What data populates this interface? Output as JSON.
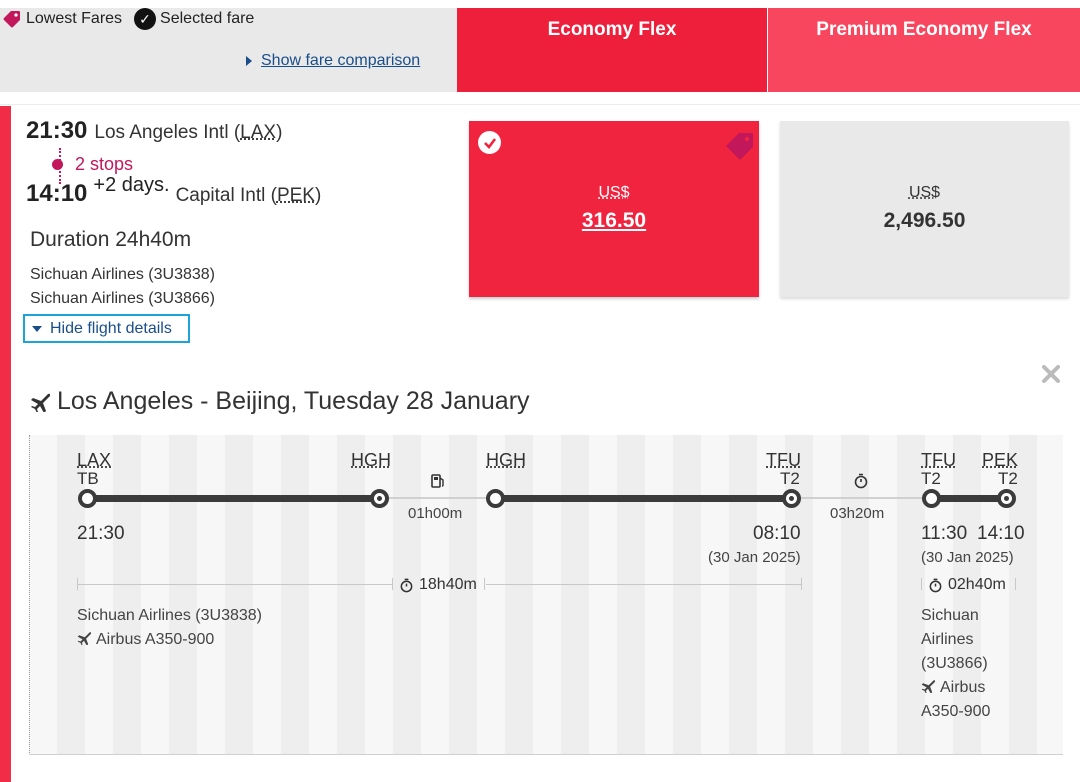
{
  "legend": {
    "lowest_fares": "Lowest Fares",
    "selected_fare": "Selected fare",
    "show_fare_comparison": "Show fare comparison",
    "tag_icon": "price-tag-icon",
    "check_icon": "checkmark-icon"
  },
  "fare_columns": {
    "economy_flex": "Economy Flex",
    "premium_economy_flex": "Premium Economy Flex"
  },
  "flight": {
    "dep_time": "21:30",
    "dep_airport_name": "Los Angeles Intl",
    "dep_code": "LAX",
    "stops": "2 stops",
    "arr_time": "14:10",
    "arr_days": "+2 days.",
    "arr_airport_name": "Capital Intl",
    "arr_code": "PEK",
    "duration": "Duration 24h40m",
    "airlines": [
      "Sichuan Airlines (3U3838)",
      "Sichuan Airlines (3U3866)"
    ],
    "hide_details": "Hide flight details"
  },
  "fares": {
    "economy": {
      "currency": "US$",
      "amount": "316.50",
      "selected": true
    },
    "premium": {
      "currency": "US$",
      "amount": "2,496.50",
      "selected": false
    }
  },
  "colors": {
    "economy_red": "#ee1f3b",
    "premium_pink": "#f9465f",
    "stops_magenta": "#c2185b",
    "link_blue": "#1a4e8a",
    "focus_cyan": "#1ea3d8"
  },
  "details": {
    "route_title": "Los Angeles - Beijing, Tuesday 28 January",
    "airports": {
      "lax": "LAX",
      "hgh1": "HGH",
      "hgh2": "HGH",
      "tfu1": "TFU",
      "tfu2": "TFU",
      "pek": "PEK"
    },
    "terminals": {
      "lax": "TB",
      "tfu1": "T2",
      "tfu2": "T2",
      "pek": "T2"
    },
    "layover1": "01h00m",
    "layover2": "03h20m",
    "times": {
      "lax_dep": "21:30",
      "tfu_arr": "08:10",
      "tfu_arr_date": "(30 Jan 2025)",
      "tfu_dep": "11:30",
      "pek_arr": "14:10",
      "tfu_dep_date": "(30 Jan 2025)"
    },
    "seg1": {
      "duration": "18h40m",
      "airline": "Sichuan Airlines (3U3838)",
      "aircraft": "Airbus A350-900"
    },
    "seg2": {
      "duration": "02h40m",
      "airline_l1": "Sichuan",
      "airline_l2": "Airlines",
      "airline_l3": "(3U3866)",
      "aircraft_l1": "Airbus",
      "aircraft_l2": "A350-900"
    }
  }
}
